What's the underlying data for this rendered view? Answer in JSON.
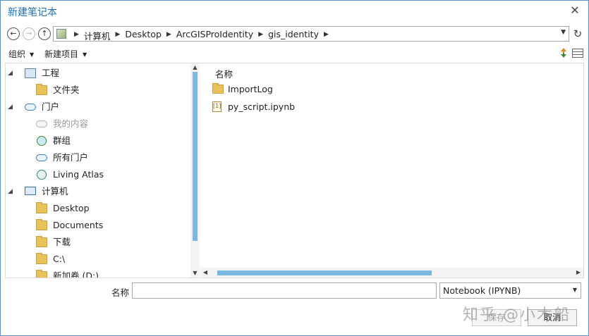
{
  "window": {
    "title": "新建笔记本",
    "close_label": "✕"
  },
  "navigation": {
    "back_icon": "back-arrow-icon",
    "forward_icon": "forward-arrow-icon",
    "up_icon": "up-arrow-icon",
    "breadcrumb": [
      "计算机",
      "Desktop",
      "ArcGISProIdentity",
      "gis_identity"
    ],
    "refresh_label": "↻"
  },
  "toolbar": {
    "organize_label": "组织",
    "new_item_label": "新建项目"
  },
  "tree": {
    "items": [
      {
        "label": "工程",
        "level": 0,
        "expanded": true,
        "icon": "project-folder-icon"
      },
      {
        "label": "文件夹",
        "level": 1,
        "icon": "folder-icon"
      },
      {
        "label": "门户",
        "level": 0,
        "expanded": true,
        "icon": "portal-cloud-icon"
      },
      {
        "label": "我的内容",
        "level": 1,
        "icon": "my-content-icon",
        "dimmed": true
      },
      {
        "label": "群组",
        "level": 1,
        "icon": "groups-icon"
      },
      {
        "label": "所有门户",
        "level": 1,
        "icon": "all-portal-cloud-icon"
      },
      {
        "label": "Living Atlas",
        "level": 1,
        "icon": "living-atlas-icon"
      },
      {
        "label": "计算机",
        "level": 0,
        "expanded": true,
        "icon": "computer-icon"
      },
      {
        "label": "Desktop",
        "level": 1,
        "icon": "folder-icon"
      },
      {
        "label": "Documents",
        "level": 1,
        "icon": "folder-icon"
      },
      {
        "label": "下载",
        "level": 1,
        "icon": "folder-icon"
      },
      {
        "label": "C:\\",
        "level": 1,
        "icon": "folder-icon"
      },
      {
        "label": "新加卷 (D:)",
        "level": 1,
        "icon": "folder-icon"
      }
    ]
  },
  "file_list": {
    "column_header": "名称",
    "items": [
      {
        "label": "ImportLog",
        "icon": "folder-icon"
      },
      {
        "label": "py_script.ipynb",
        "icon": "notebook-file-icon",
        "icon_text": "[1]"
      }
    ]
  },
  "footer": {
    "name_label": "名称",
    "name_value": "",
    "file_type": "Notebook (IPYNB)",
    "save_label": "保存",
    "cancel_label": "取消"
  },
  "watermark": "知乎 @小木船",
  "colors": {
    "accent": "#1f6fb5",
    "scroll_thumb": "#7ab8e3",
    "folder": "#e8c15a"
  }
}
